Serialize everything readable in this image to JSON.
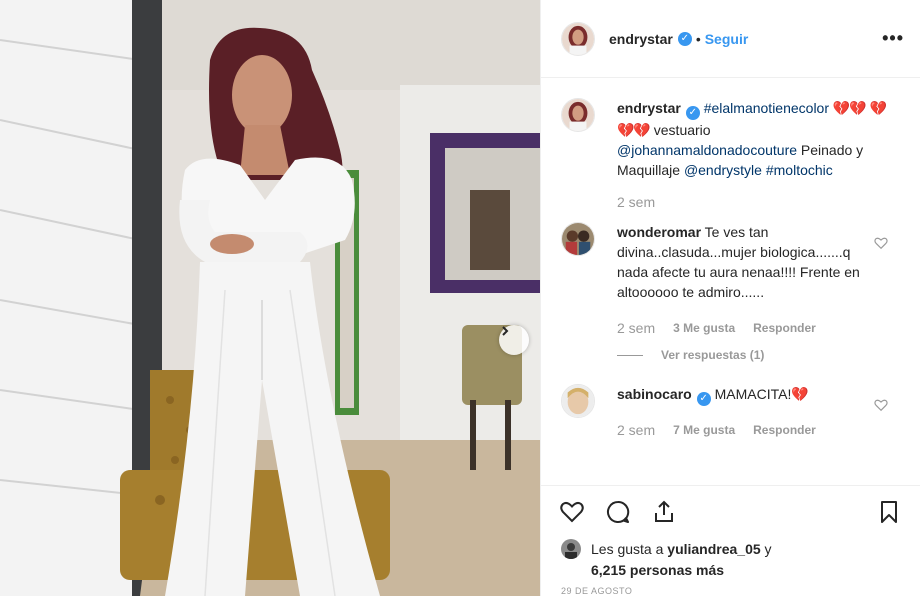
{
  "post": {
    "username": "endrystar",
    "follow_label": "Seguir",
    "dot": "•",
    "more_label": "•••"
  },
  "caption": {
    "username": "endrystar",
    "hashtag1": "#elalmanotienecolor",
    "hearts1": "💔💔",
    "hearts2": "💔💔💔",
    "text1": " vestuario ",
    "mention1": "@johannamaldonadocouture",
    "text2": " Peinado y Maquillaje ",
    "mention2": "@endrystyle",
    "hashtag2": "#moltochic",
    "time": "2 sem"
  },
  "comments": [
    {
      "username": "wonderomar",
      "text": "Te ves tan divina..clasuda...mujer biologica.......q nada afecte tu aura nenaa!!!! Frente en altoooooo te admiro......",
      "time": "2 sem",
      "likes": "3 Me gusta",
      "reply": "Responder",
      "view_replies": "Ver respuestas (1)"
    },
    {
      "username": "sabinocaro",
      "text": "MAMACITA!",
      "emoji": "💔",
      "time": "2 sem",
      "likes": "7 Me gusta",
      "reply": "Responder"
    }
  ],
  "likes": {
    "prefix": "Les gusta a ",
    "user": "yuliandrea_05",
    "conj": " y",
    "count": "6,215 personas más"
  },
  "date": "29 DE AGOSTO",
  "colors": {
    "accent": "#3897f0",
    "tag": "#003569",
    "muted": "#999999"
  }
}
